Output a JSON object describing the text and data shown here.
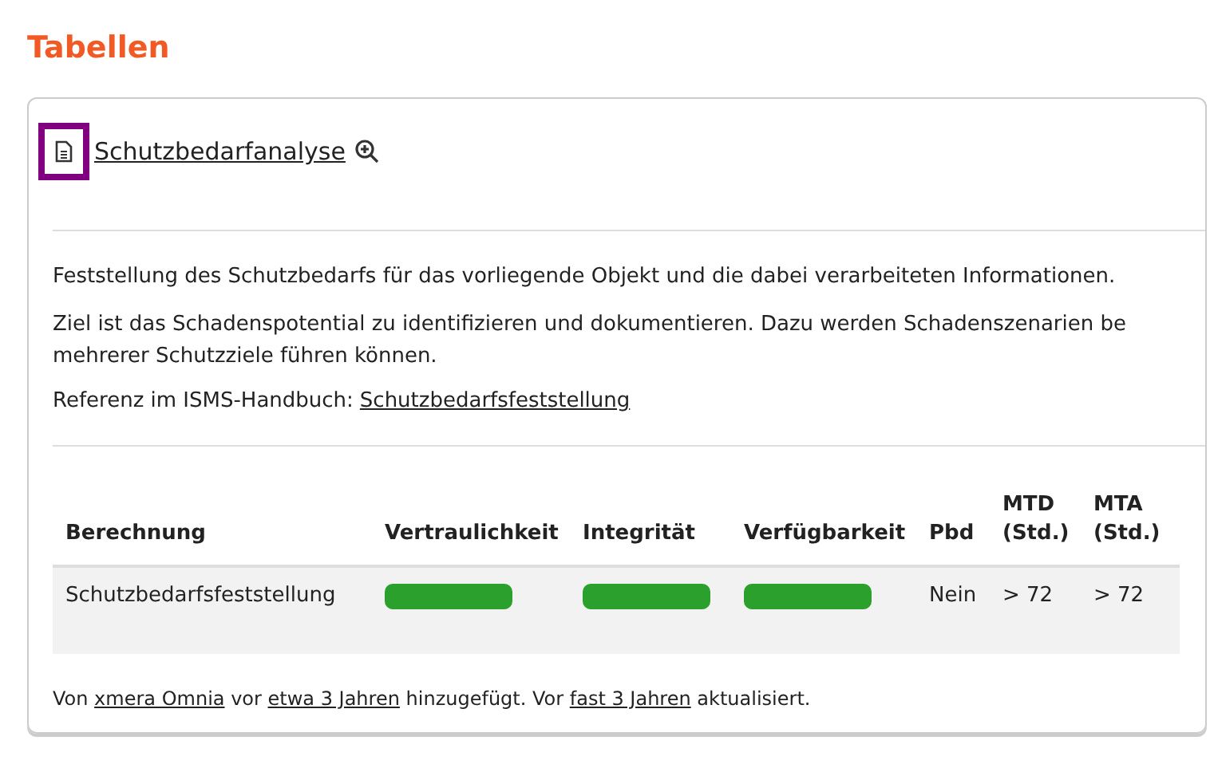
{
  "heading": "Tabellen",
  "card": {
    "title": "Schutzbedarfanalyse",
    "icon_focused": true,
    "paragraphs": [
      "Feststellung des Schutzbedarfs für das vorliegende Objekt und die dabei verarbeiteten Informationen.",
      "Ziel ist das Schadenspotential zu identifizieren und dokumentieren. Dazu werden Schadenszenarien be\nmehrerer Schutzziele führen können."
    ],
    "reference": {
      "label": "Referenz im ISMS-Handbuch:",
      "link": "Schutzbedarfsfeststellung"
    },
    "table": {
      "columns": [
        "Berechnung",
        "Vertraulichkeit",
        "Integrität",
        "Verfügbarkeit",
        "Pbd",
        "MTD (Std.)",
        "MTA (Std.)"
      ],
      "rows": [
        {
          "cells": [
            {
              "kind": "text",
              "text": "Schutzbedarfsfeststellung"
            },
            {
              "kind": "bar",
              "color": "#2ca02c"
            },
            {
              "kind": "bar",
              "color": "#2ca02c"
            },
            {
              "kind": "bar",
              "color": "#2ca02c"
            },
            {
              "kind": "text",
              "text": "Nein"
            },
            {
              "kind": "text",
              "text": "> 72"
            },
            {
              "kind": "text",
              "text": "> 72"
            }
          ]
        }
      ]
    },
    "footer": [
      {
        "kind": "text",
        "text": "Von "
      },
      {
        "kind": "link",
        "text": "xmera Omnia"
      },
      {
        "kind": "text",
        "text": " vor "
      },
      {
        "kind": "link",
        "text": "etwa 3 Jahren"
      },
      {
        "kind": "text",
        "text": " hinzugefügt. Vor "
      },
      {
        "kind": "link",
        "text": "fast 3 Jahren"
      },
      {
        "kind": "text",
        "text": " aktualisiert."
      }
    ]
  }
}
